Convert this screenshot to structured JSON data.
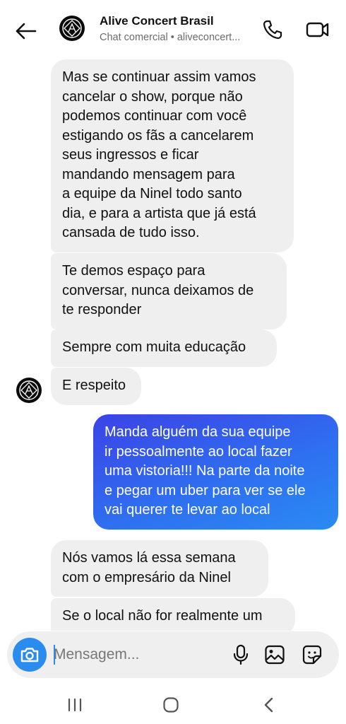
{
  "header": {
    "back_icon": "arrow-left-icon",
    "title": "Alive Concert Brasil",
    "subtitle": "Chat comercial • aliveconcert...",
    "call_icon": "phone-icon",
    "video_icon": "video-camera-icon"
  },
  "messages": [
    {
      "sender": "them",
      "text": "Mas se continuar assim vamos\ncancelar o show, porque não\npodemos continuar com você\nestigando os fãs a cancelarem\nseus ingressos e ficar\nmandando mensagem para\na equipe da Ninel todo santo\ndia, e para a artista que já está\ncansada de tudo isso."
    },
    {
      "sender": "them",
      "text": "Te demos espaço para\nconversar, nunca deixamos de\nte responder"
    },
    {
      "sender": "them",
      "text": "Sempre com muita educação"
    },
    {
      "sender": "them",
      "text": "E respeito"
    },
    {
      "sender": "me",
      "text": "Manda alguém da sua equipe\nir pessoalmente ao local fazer\numa vistoria!!! Na parte da noite\ne pegar um uber para ver se ele\nvai querer te levar ao local"
    },
    {
      "sender": "them",
      "text": "Nós vamos lá essa semana\ncom o empresário da Ninel"
    },
    {
      "sender": "them",
      "text": "Se o local não for realmente um"
    }
  ],
  "composer": {
    "camera_icon": "camera-icon",
    "placeholder": "Mensagem...",
    "value": "",
    "mic_icon": "microphone-icon",
    "gallery_icon": "image-icon",
    "sticker_icon": "sticker-icon"
  },
  "system_nav": {
    "recents_icon": "recent-apps-icon",
    "home_icon": "home-icon",
    "back_icon": "back-chevron-icon"
  },
  "colors": {
    "incoming_bubble": "#efefef",
    "outgoing_gradient_start": "#3c42e6",
    "outgoing_gradient_end": "#2a8bf2",
    "camera_button": "#2b8cf0",
    "avatar_bg": "#0b0b0b"
  }
}
